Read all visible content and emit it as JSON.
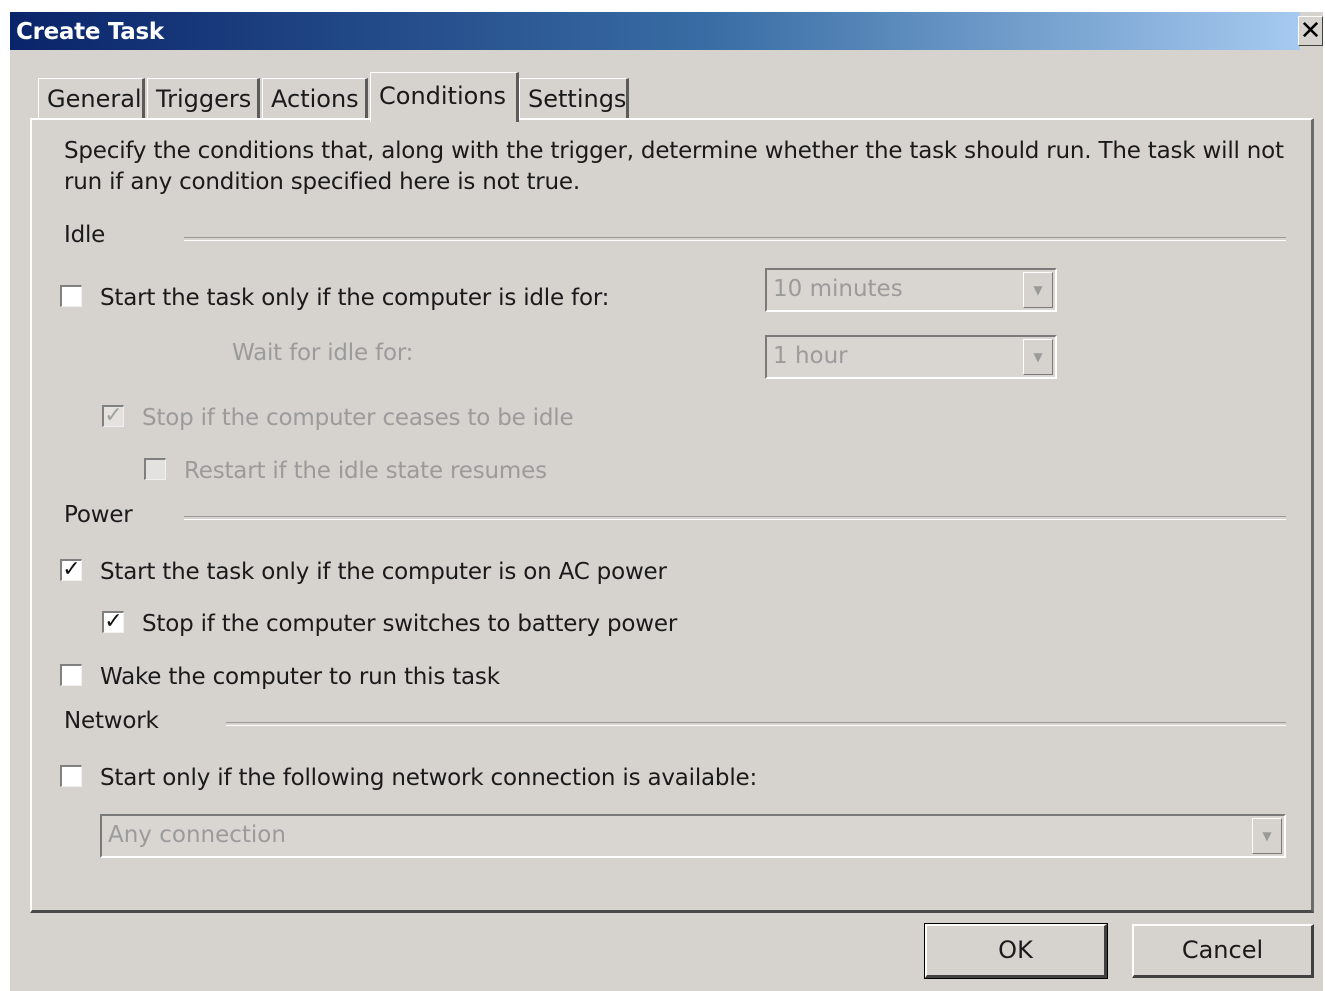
{
  "window": {
    "title": "Create Task"
  },
  "tabs": [
    "General",
    "Triggers",
    "Actions",
    "Conditions",
    "Settings"
  ],
  "active_tab": "Conditions",
  "description": [
    "Specify the conditions that, along with the trigger, determine whether the task should run.  The task will not",
    "run  if any condition specified here is not true."
  ],
  "idle": {
    "heading": "Idle",
    "start_if_idle_label": "Start the task only if the computer is idle for:",
    "start_if_idle_checked": false,
    "idle_duration": "10 minutes",
    "wait_label": "Wait for idle for:",
    "wait_duration": "1 hour",
    "stop_if_ceases_label": "Stop if the computer ceases to be idle",
    "stop_if_ceases_checked": true,
    "restart_label": "Restart if the idle state resumes",
    "restart_checked": false
  },
  "power": {
    "heading": "Power",
    "ac_power_label": "Start the task only if the computer is on AC power",
    "ac_power_checked": true,
    "battery_label": "Stop if the computer switches to battery power",
    "battery_checked": true,
    "wake_label": "Wake the computer to run this task",
    "wake_checked": false
  },
  "network": {
    "heading": "Network",
    "connection_label": "Start only if the following network connection is available:",
    "connection_checked": false,
    "connection_value": "Any connection"
  },
  "buttons": {
    "ok": "OK",
    "cancel": "Cancel"
  },
  "check_glyph": "✓",
  "close_glyph": "✕",
  "dropdown_glyph": "▼"
}
